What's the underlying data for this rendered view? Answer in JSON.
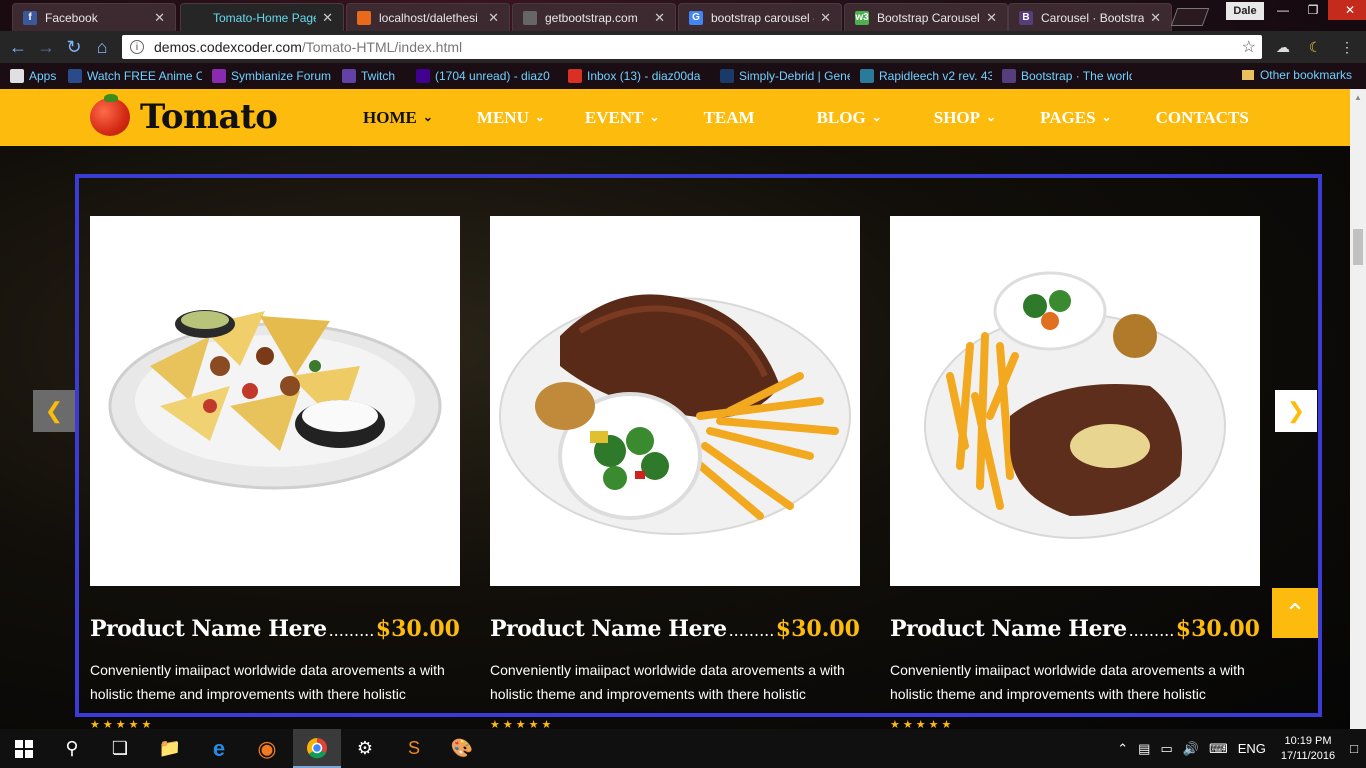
{
  "browser": {
    "tabs": [
      {
        "title": "Facebook",
        "fav": "f",
        "favcolor": "#3b5998",
        "active": false
      },
      {
        "title": "Tomato-Home Page",
        "fav": "",
        "favcolor": "#262626",
        "active": true
      },
      {
        "title": "localhost/dalethesi",
        "fav": "",
        "favcolor": "#e86a1a",
        "active": false
      },
      {
        "title": "getbootstrap.com",
        "fav": "",
        "favcolor": "#666",
        "active": false
      },
      {
        "title": "bootstrap carousel -",
        "fav": "G",
        "favcolor": "#4285f4",
        "active": false
      },
      {
        "title": "Bootstrap Carousel",
        "fav": "w3",
        "favcolor": "#4caf50",
        "active": false
      },
      {
        "title": "Carousel · Bootstrap",
        "fav": "B",
        "favcolor": "#563d7c",
        "active": false
      }
    ],
    "user": "Dale",
    "url_host": "demos.codexcoder.com",
    "url_path": "/Tomato-HTML/index.html",
    "bookmarks": [
      {
        "label": "Apps",
        "icon": "apps-grid-icon",
        "color": "#e0e0e0"
      },
      {
        "label": "Watch FREE Anime O",
        "icon": "anime-icon",
        "color": "#2a4a8a"
      },
      {
        "label": "Symbianize Forum",
        "icon": "symbianize-icon",
        "color": "#8a2ab0"
      },
      {
        "label": "Twitch",
        "icon": "twitch-icon",
        "color": "#6441a5"
      },
      {
        "label": "(1704 unread) - diaz0",
        "icon": "yahoo-icon",
        "color": "#400090"
      },
      {
        "label": "Inbox (13) - diaz00da",
        "icon": "gmail-icon",
        "color": "#d93025"
      },
      {
        "label": "Simply-Debrid | Gene",
        "icon": "sd-icon",
        "color": "#1a3a6a"
      },
      {
        "label": "Rapidleech v2 rev. 43",
        "icon": "rapidleech-icon",
        "color": "#2a7a9a"
      },
      {
        "label": "Bootstrap · The world",
        "icon": "bootstrap-icon",
        "color": "#563d7c"
      }
    ],
    "other_bookmarks": "Other bookmarks"
  },
  "site": {
    "logo": "Tomato",
    "menu": [
      {
        "label": "HOME",
        "dropdown": true,
        "active": true
      },
      {
        "label": "MENU",
        "dropdown": true,
        "active": false
      },
      {
        "label": "EVENT",
        "dropdown": true,
        "active": false
      },
      {
        "label": "TEAM",
        "dropdown": false,
        "active": false
      },
      {
        "label": "BLOG",
        "dropdown": true,
        "active": false
      },
      {
        "label": "SHOP",
        "dropdown": true,
        "active": false
      },
      {
        "label": "PAGES",
        "dropdown": true,
        "active": false
      },
      {
        "label": "CONTACTS",
        "dropdown": false,
        "active": false
      }
    ],
    "accent": "#fdbb0d",
    "frame_color": "#3b3bd6"
  },
  "products": [
    {
      "name": "Product Name Here",
      "dots": "...........",
      "price": "$30.00",
      "desc": "Conveniently imaiipact worldwide data arovements a with holistic theme and improvements with there holistic",
      "dish": "nachos",
      "rating": 5
    },
    {
      "name": "Product Name Here",
      "dots": "...........",
      "price": "$30.00",
      "desc": "Conveniently imaiipact worldwide data arovements a with holistic theme and improvements with there holistic",
      "dish": "ribs",
      "rating": 5
    },
    {
      "name": "Product Name Here",
      "dots": "...........",
      "price": "$30.00",
      "desc": "Conveniently imaiipact worldwide data arovements a with holistic theme and improvements with there holistic",
      "dish": "steak",
      "rating": 5
    }
  ],
  "taskbar": {
    "lang": "ENG",
    "time": "10:19 PM",
    "date": "17/11/2016"
  }
}
